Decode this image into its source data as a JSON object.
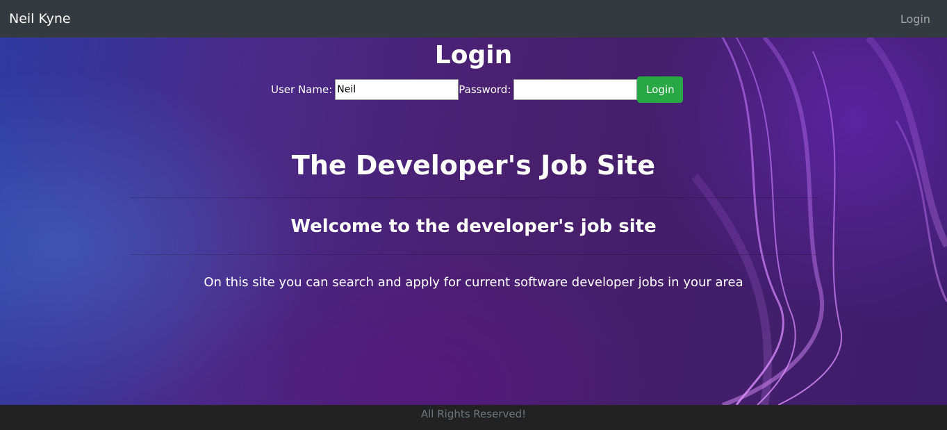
{
  "navbar": {
    "brand": "Neil Kyne",
    "login_link": "Login"
  },
  "login": {
    "title": "Login",
    "username_label": "User Name:",
    "username_value": "Neil",
    "password_label": "Password:",
    "password_value": "",
    "button_label": "Login"
  },
  "main": {
    "title": "The Developer's Job Site",
    "welcome": "Welcome to the developer's job site",
    "description": "On this site you can search and apply for current software developer jobs in your area"
  },
  "footer": {
    "text": "All Rights Reserved!"
  },
  "colors": {
    "navbar": "#343a40",
    "button": "#28a745",
    "footer": "#222222"
  }
}
